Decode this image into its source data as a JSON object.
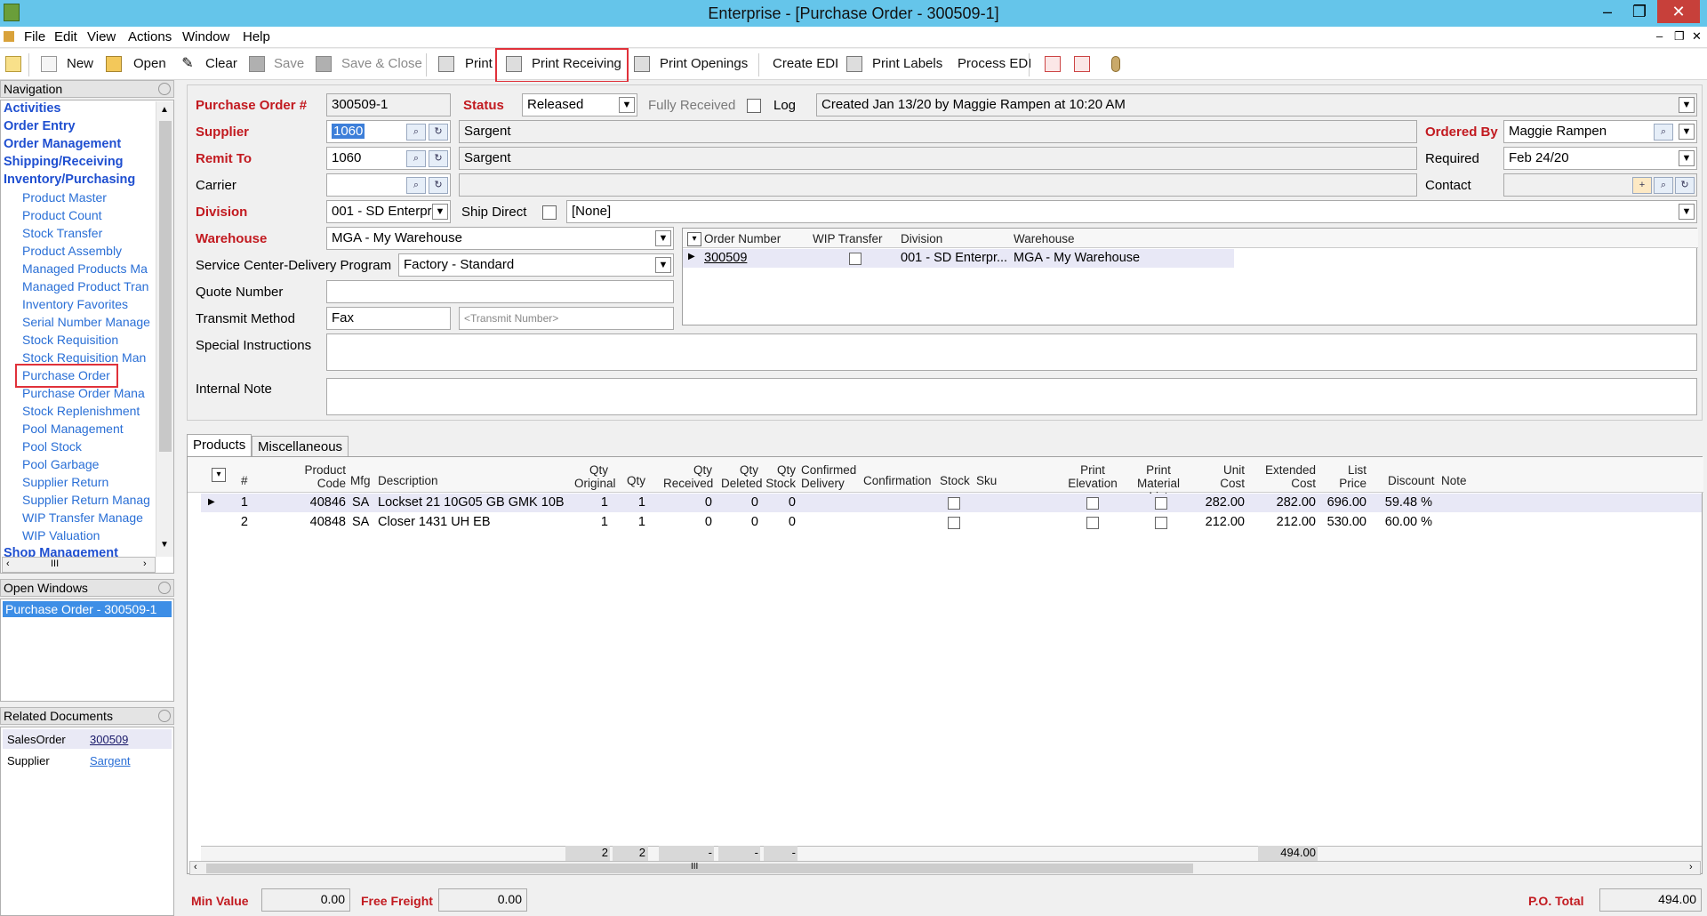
{
  "window": {
    "title": "Enterprise - [Purchase Order - 300509-1]",
    "min": "–",
    "max": "❐",
    "close": "✕"
  },
  "menu": [
    "File",
    "Edit",
    "View",
    "Actions",
    "Window",
    "Help"
  ],
  "mdi_controls": [
    "–",
    "❐",
    "✕"
  ],
  "toolbar": {
    "new": "New",
    "open": "Open",
    "clear": "Clear",
    "save": "Save",
    "save_close": "Save & Close",
    "print": "Print",
    "print_receiving": "Print Receiving",
    "print_openings": "Print Openings",
    "create_edi": "Create EDI",
    "print_labels": "Print Labels",
    "process_edi": "Process EDI"
  },
  "navigation": {
    "title": "Navigation",
    "categories": [
      "Activities",
      "Order Entry",
      "Order Management",
      "Shipping/Receiving",
      "Inventory/Purchasing"
    ],
    "subitems": [
      "Product Master",
      "Product Count",
      "Stock Transfer",
      "Product Assembly",
      "Managed Products Ma",
      "Managed Product Tran",
      "Inventory Favorites",
      "Serial Number Manage",
      "Stock Requisition",
      "Stock Requisition Man",
      "Purchase Order",
      "Purchase Order Mana",
      "Stock Replenishment",
      "Pool Management",
      "Pool Stock",
      "Pool Garbage",
      "Supplier Return",
      "Supplier Return Manag",
      "WIP Transfer Manage",
      "WIP Valuation"
    ],
    "last_category": "Shop Management",
    "scroll_thumb": "III"
  },
  "open_windows": {
    "title": "Open Windows",
    "items": [
      "Purchase Order - 300509-1"
    ]
  },
  "related_documents": {
    "title": "Related Documents",
    "rows": [
      {
        "type": "SalesOrder",
        "value": "300509"
      },
      {
        "type": "Supplier",
        "value": "Sargent"
      }
    ]
  },
  "form": {
    "po_label": "Purchase Order #",
    "po_value": "300509-1",
    "status_label": "Status",
    "status_value": "Released",
    "fully_received_label": "Fully Received",
    "log_label": "Log",
    "log_value": "Created Jan 13/20 by Maggie Rampen at 10:20 AM",
    "supplier_label": "Supplier",
    "supplier_code": "1060",
    "supplier_name": "Sargent",
    "remit_label": "Remit To",
    "remit_code": "1060",
    "remit_name": "Sargent",
    "carrier_label": "Carrier",
    "carrier_code": "",
    "carrier_name": "",
    "division_label": "Division",
    "division_value": "001 - SD Enterpr",
    "ship_direct_label": "Ship Direct",
    "ship_direct_value": "[None]",
    "warehouse_label": "Warehouse",
    "warehouse_value": "MGA - My Warehouse",
    "scdp_label": "Service Center-Delivery Program",
    "scdp_value": "Factory - Standard",
    "quote_label": "Quote Number",
    "quote_value": "",
    "transmit_label": "Transmit Method",
    "transmit_value": "Fax",
    "transmit_number_placeholder": "<Transmit Number>",
    "special_label": "Special Instructions",
    "internal_label": "Internal Note",
    "ordered_by_label": "Ordered By",
    "ordered_by_value": "Maggie Rampen",
    "required_label": "Required",
    "required_value": "Feb 24/20",
    "contact_label": "Contact",
    "contact_value": ""
  },
  "orders_grid": {
    "headers": [
      "Order Number",
      "WIP Transfer",
      "Division",
      "Warehouse"
    ],
    "rows": [
      {
        "order": "300509",
        "division": "001 - SD Enterpr...",
        "warehouse": "MGA - My Warehouse"
      }
    ]
  },
  "tabs": [
    "Products",
    "Miscellaneous"
  ],
  "products": {
    "headers": [
      "#",
      "Product Code",
      "Mfg",
      "Description",
      "Qty Original",
      "Qty",
      "Qty Received",
      "Qty Deleted",
      "Qty Stock",
      "Confirmed Delivery",
      "Confirmation",
      "Stock",
      "Sku",
      "Print Elevation",
      "Print Material List",
      "Unit Cost",
      "Extended Cost",
      "List Price",
      "Discount",
      "Note"
    ],
    "rows": [
      {
        "n": "1",
        "code": "40846",
        "mfg": "SA",
        "desc": "Lockset 21 10G05 GB GMK 10B",
        "qo": "1",
        "q": "1",
        "qr": "0",
        "qd": "0",
        "qs": "0",
        "unit": "282.00",
        "ext": "282.00",
        "list": "696.00",
        "disc": "59.48 %"
      },
      {
        "n": "2",
        "code": "40848",
        "mfg": "SA",
        "desc": "Closer 1431 UH EB",
        "qo": "1",
        "q": "1",
        "qr": "0",
        "qd": "0",
        "qs": "0",
        "unit": "212.00",
        "ext": "212.00",
        "list": "530.00",
        "disc": "60.00 %"
      }
    ],
    "totals": {
      "qo": "2",
      "q": "2",
      "qr": "-",
      "qd": "-",
      "qs": "-",
      "ext": "494.00"
    },
    "scroll_thumb": "III"
  },
  "footer": {
    "min_value_label": "Min Value",
    "min_value": "0.00",
    "free_freight_label": "Free Freight",
    "free_freight": "0.00",
    "po_total_label": "P.O. Total",
    "po_total": "494.00"
  }
}
